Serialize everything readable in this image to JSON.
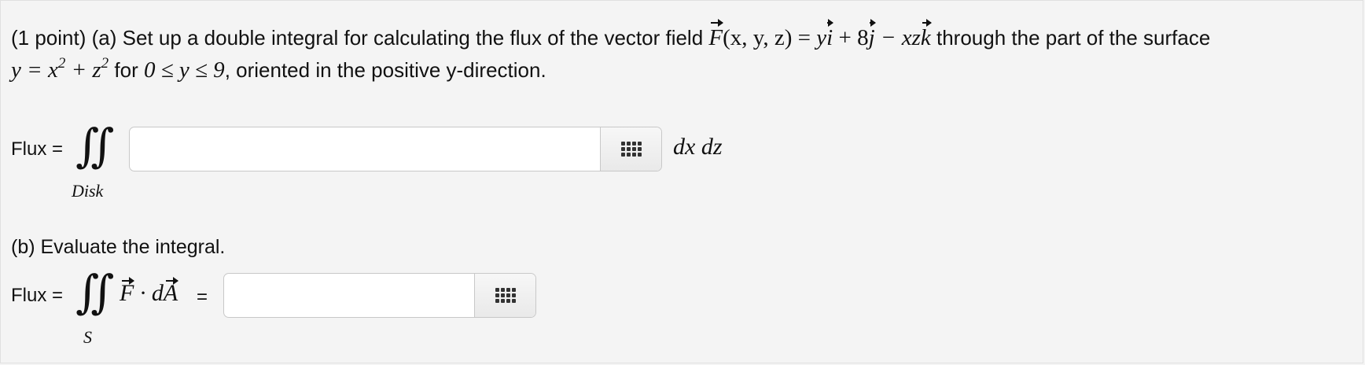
{
  "part_a": {
    "intro": "(1 point) (a) Set up a double integral for calculating the flux of the vector field ",
    "field_F": "F",
    "field_args": "(x, y, z) = ",
    "term1": "y",
    "term1_unit": "i",
    "term2": " + 8",
    "term2_unit": "j",
    "term3": " − xz",
    "term3_unit": "k",
    "text_after_field": " through the part of the surface",
    "surface_y": "y = x",
    "surface_exp1": "2",
    "surface_plus": " + z",
    "surface_exp2": "2",
    "text_for": " for ",
    "range": "0 ≤ y ≤ 9",
    "text_orientation": ", oriented in the positive y-direction.",
    "flux_label": "Flux =",
    "integral_sign": "∬",
    "integral_region": "Disk",
    "input_value": "",
    "trailing_differentials": "dx dz"
  },
  "part_b": {
    "title": "(b) Evaluate the integral.",
    "flux_label": "Flux =",
    "integral_sign": "∬",
    "integral_region": "S",
    "integrand_F": "F",
    "integrand_dot": " · d",
    "integrand_A": "A",
    "equals": "=",
    "input_value": ""
  },
  "icons": {
    "palette": "grid-icon"
  }
}
